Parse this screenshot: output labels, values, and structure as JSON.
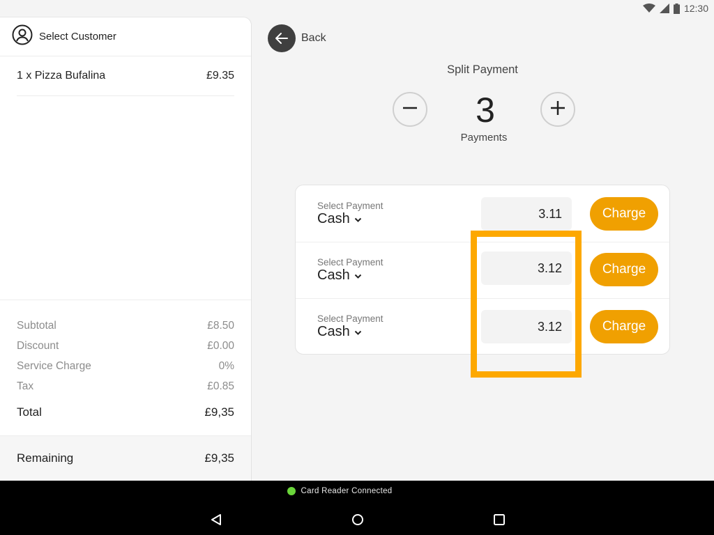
{
  "status_bar": {
    "time": "12:30",
    "icons": [
      "wifi-icon",
      "cell-signal-icon",
      "battery-icon"
    ]
  },
  "order_panel": {
    "customer": {
      "icon": "user-circle-icon",
      "label": "Select Customer"
    },
    "items": [
      {
        "label": "1 x Pizza Bufalina",
        "price": "£9.35"
      }
    ],
    "summary": [
      {
        "label": "Subtotal",
        "value": "£8.50"
      },
      {
        "label": "Discount",
        "value": "£0.00"
      },
      {
        "label": "Service Charge",
        "value": "0%"
      },
      {
        "label": "Tax",
        "value": "£0.85"
      }
    ],
    "total": {
      "label": "Total",
      "value": "£9,35"
    },
    "remaining": {
      "label": "Remaining",
      "value": "£9,35"
    }
  },
  "header": {
    "back_label": "Back",
    "back_icon": "arrow-left-icon"
  },
  "split": {
    "title": "Split Payment",
    "count": "3",
    "count_label": "Payments",
    "minus_icon": "minus-icon",
    "plus_icon": "plus-icon"
  },
  "payments": [
    {
      "select_label": "Select Payment",
      "method": "Cash",
      "amount": "3.11",
      "charge_label": "Charge"
    },
    {
      "select_label": "Select Payment",
      "method": "Cash",
      "amount": "3.12",
      "charge_label": "Charge"
    },
    {
      "select_label": "Select Payment",
      "method": "Cash",
      "amount": "3.12",
      "charge_label": "Charge"
    }
  ],
  "colors": {
    "accent": "#f0a001",
    "highlight": "#fda800",
    "connected": "#6ad53a"
  },
  "bottom_bar": {
    "reader_status": "Card Reader Connected",
    "nav": [
      "back-nav-icon",
      "home-nav-icon",
      "recents-nav-icon"
    ]
  }
}
